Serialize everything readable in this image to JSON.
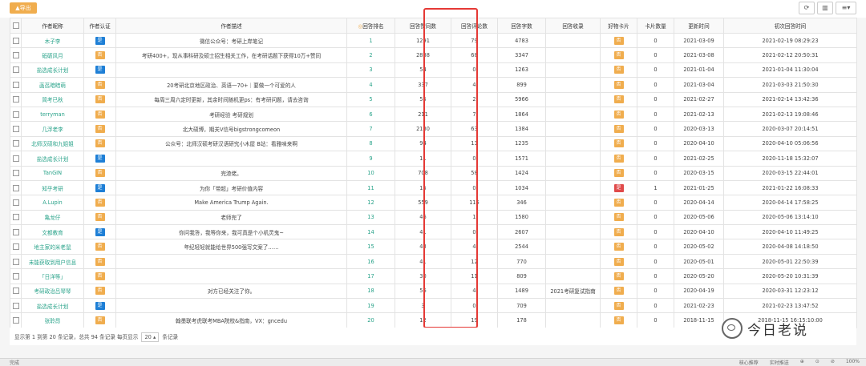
{
  "toolbar": {
    "export_label": "▲导出",
    "icon_refresh": "⟳",
    "icon_columns": "▥",
    "icon_menu": "≡▾"
  },
  "headers": [
    "",
    "作者昵称",
    "作者认证",
    "作者描述",
    "回答排名",
    "回答赞同数",
    "回答评论数",
    "回答字数",
    "回答收录",
    "好物卡片",
    "卡片数量",
    "更新时间",
    "初次回答时间"
  ],
  "rank_header_icon": "◎",
  "colors": {
    "orange": "#f0ad4e",
    "blue": "#1e7fd6",
    "red": "#e04a4a",
    "highlight": "#e53935"
  },
  "badges": {
    "orange": "否",
    "blue": "是",
    "red": "是"
  },
  "rows": [
    {
      "name": "木子李",
      "cert": "blue",
      "desc": "微信公众号：考研上岸笔记",
      "rank": "1",
      "votes": "1291",
      "comments": "79",
      "words": "4783",
      "collect": "",
      "card": "orange",
      "count": "0",
      "updated": "2021-03-09",
      "first": "2021-02-19 08:29:23"
    },
    {
      "name": "砥砺风月",
      "cert": "orange",
      "desc": "考研400+，现从事科研及硕士招生相关工作，在考研话题下获得10万+赞同",
      "rank": "2",
      "votes": "2838",
      "comments": "68",
      "words": "3347",
      "collect": "",
      "card": "orange",
      "count": "0",
      "updated": "2021-03-08",
      "first": "2021-02-12 20:50:31"
    },
    {
      "name": "盐选成长计划",
      "cert": "blue",
      "desc": "",
      "rank": "3",
      "votes": "54",
      "comments": "0",
      "words": "1263",
      "collect": "",
      "card": "orange",
      "count": "0",
      "updated": "2021-01-04",
      "first": "2021-01-04 11:30:04"
    },
    {
      "name": "菡萏暗暗萌",
      "cert": "orange",
      "desc": "20考研北京地区政治、英语一70+｜要做一个可爱的人",
      "rank": "4",
      "votes": "337",
      "comments": "4",
      "words": "899",
      "collect": "",
      "card": "orange",
      "count": "0",
      "updated": "2021-03-04",
      "first": "2021-03-03 21:50:30"
    },
    {
      "name": "简考已秋",
      "cert": "orange",
      "desc": "每周三周六定时更新，其余时间随机更ps：有考研问题，请去咨询",
      "rank": "5",
      "votes": "55",
      "comments": "2",
      "words": "5966",
      "collect": "",
      "card": "orange",
      "count": "0",
      "updated": "2021-02-27",
      "first": "2021-02-14 13:42:36"
    },
    {
      "name": "terryman",
      "cert": "orange",
      "desc": "考研经验 考研规划",
      "rank": "6",
      "votes": "211",
      "comments": "7",
      "words": "1864",
      "collect": "",
      "card": "orange",
      "count": "0",
      "updated": "2021-02-13",
      "first": "2021-02-13 19:08:46"
    },
    {
      "name": "几浮老李",
      "cert": "orange",
      "desc": "北大硕博，期关V信号bigstrongcomeon",
      "rank": "7",
      "votes": "2130",
      "comments": "63",
      "words": "1384",
      "collect": "",
      "card": "orange",
      "count": "0",
      "updated": "2020-03-13",
      "first": "2020-03-07 20:14:51"
    },
    {
      "name": "北师汉硕和九姐姐",
      "cert": "orange",
      "desc": "公众号：北师汉硕考研汉语研究小木屋 B站：看雅味来啊",
      "rank": "8",
      "votes": "94",
      "comments": "13",
      "words": "1235",
      "collect": "",
      "card": "orange",
      "count": "0",
      "updated": "2020-04-10",
      "first": "2020-04-10 05:06:56"
    },
    {
      "name": "盐选成长计划",
      "cert": "blue",
      "desc": "",
      "rank": "9",
      "votes": "11",
      "comments": "0",
      "words": "1571",
      "collect": "",
      "card": "orange",
      "count": "0",
      "updated": "2021-02-25",
      "first": "2020-11-18 15:32:07"
    },
    {
      "name": "TanGIN",
      "cert": "orange",
      "desc": "完渣佬。",
      "rank": "10",
      "votes": "708",
      "comments": "58",
      "words": "1424",
      "collect": "",
      "card": "orange",
      "count": "0",
      "updated": "2020-03-15",
      "first": "2020-03-15 22:44:01"
    },
    {
      "name": "知乎考研",
      "cert": "blue",
      "desc": "为你「带超」考研价值内容",
      "rank": "11",
      "votes": "15",
      "comments": "0",
      "words": "1034",
      "collect": "",
      "card": "red",
      "count": "1",
      "updated": "2021-01-25",
      "first": "2021-01-22 16:08:33"
    },
    {
      "name": "A.Lupin",
      "cert": "orange",
      "desc": "Make America Trump Again.",
      "rank": "12",
      "votes": "559",
      "comments": "115",
      "words": "346",
      "collect": "",
      "card": "orange",
      "count": "0",
      "updated": "2020-04-14",
      "first": "2020-04-14 17:58:25"
    },
    {
      "name": "亀龙仔",
      "cert": "orange",
      "desc": "老师完了",
      "rank": "13",
      "votes": "46",
      "comments": "1",
      "words": "1580",
      "collect": "",
      "card": "orange",
      "count": "0",
      "updated": "2020-05-06",
      "first": "2020-05-06 13:14:10"
    },
    {
      "name": "文都教育",
      "cert": "blue",
      "desc": "你问我答，我等你来，我可真是个小机灵鬼~",
      "rank": "14",
      "votes": "41",
      "comments": "0",
      "words": "2607",
      "collect": "",
      "card": "orange",
      "count": "0",
      "updated": "2020-04-10",
      "first": "2020-04-10 11:49:25"
    },
    {
      "name": "地主家的米老鼠",
      "cert": "orange",
      "desc": "年纪轻轻就能给世界500强写文案了……",
      "rank": "15",
      "votes": "43",
      "comments": "4",
      "words": "2544",
      "collect": "",
      "card": "orange",
      "count": "0",
      "updated": "2020-05-02",
      "first": "2020-04-08 14:18:50"
    },
    {
      "name": "未能获取到用户信息",
      "cert": "orange",
      "desc": "",
      "rank": "16",
      "votes": "41",
      "comments": "12",
      "words": "770",
      "collect": "",
      "card": "orange",
      "count": "0",
      "updated": "2020-05-01",
      "first": "2020-05-01 22:50:39"
    },
    {
      "name": "「日洋等」",
      "cert": "orange",
      "desc": "",
      "rank": "17",
      "votes": "30",
      "comments": "11",
      "words": "809",
      "collect": "",
      "card": "orange",
      "count": "0",
      "updated": "2020-05-20",
      "first": "2020-05-20 10:31:39"
    },
    {
      "name": "考研政治吕琴琴",
      "cert": "orange",
      "desc": "对方已经关注了你。",
      "rank": "18",
      "votes": "56",
      "comments": "4",
      "words": "1489",
      "collect": "2021考研复试指南",
      "card": "orange",
      "count": "0",
      "updated": "2020-04-19",
      "first": "2020-03-31 12:23:12"
    },
    {
      "name": "盐选成长计划",
      "cert": "blue",
      "desc": "",
      "rank": "19",
      "votes": "3",
      "comments": "0",
      "words": "709",
      "collect": "",
      "card": "orange",
      "count": "0",
      "updated": "2021-02-23",
      "first": "2021-02-23 13:47:52"
    },
    {
      "name": "张聆昂",
      "cert": "orange",
      "desc": "翰墨联考虎联考MBA院校&指南，VX：gncedu",
      "rank": "20",
      "votes": "12",
      "comments": "19",
      "words": "178",
      "collect": "",
      "card": "orange",
      "count": "0",
      "updated": "2018-11-15",
      "first": "2018-11-15 16:15:10:00"
    }
  ],
  "footer": {
    "prefix": "显示第 1 到第 20 条记录，总共 94 条记录 每页显示",
    "page_size": "20 ▴",
    "suffix": "条记录"
  },
  "watermark": "今日老说",
  "statusbar": {
    "left": "完成",
    "items": [
      "核心推荐",
      "实时推送",
      "⊕",
      "⊙",
      "⊘",
      "100%"
    ]
  }
}
